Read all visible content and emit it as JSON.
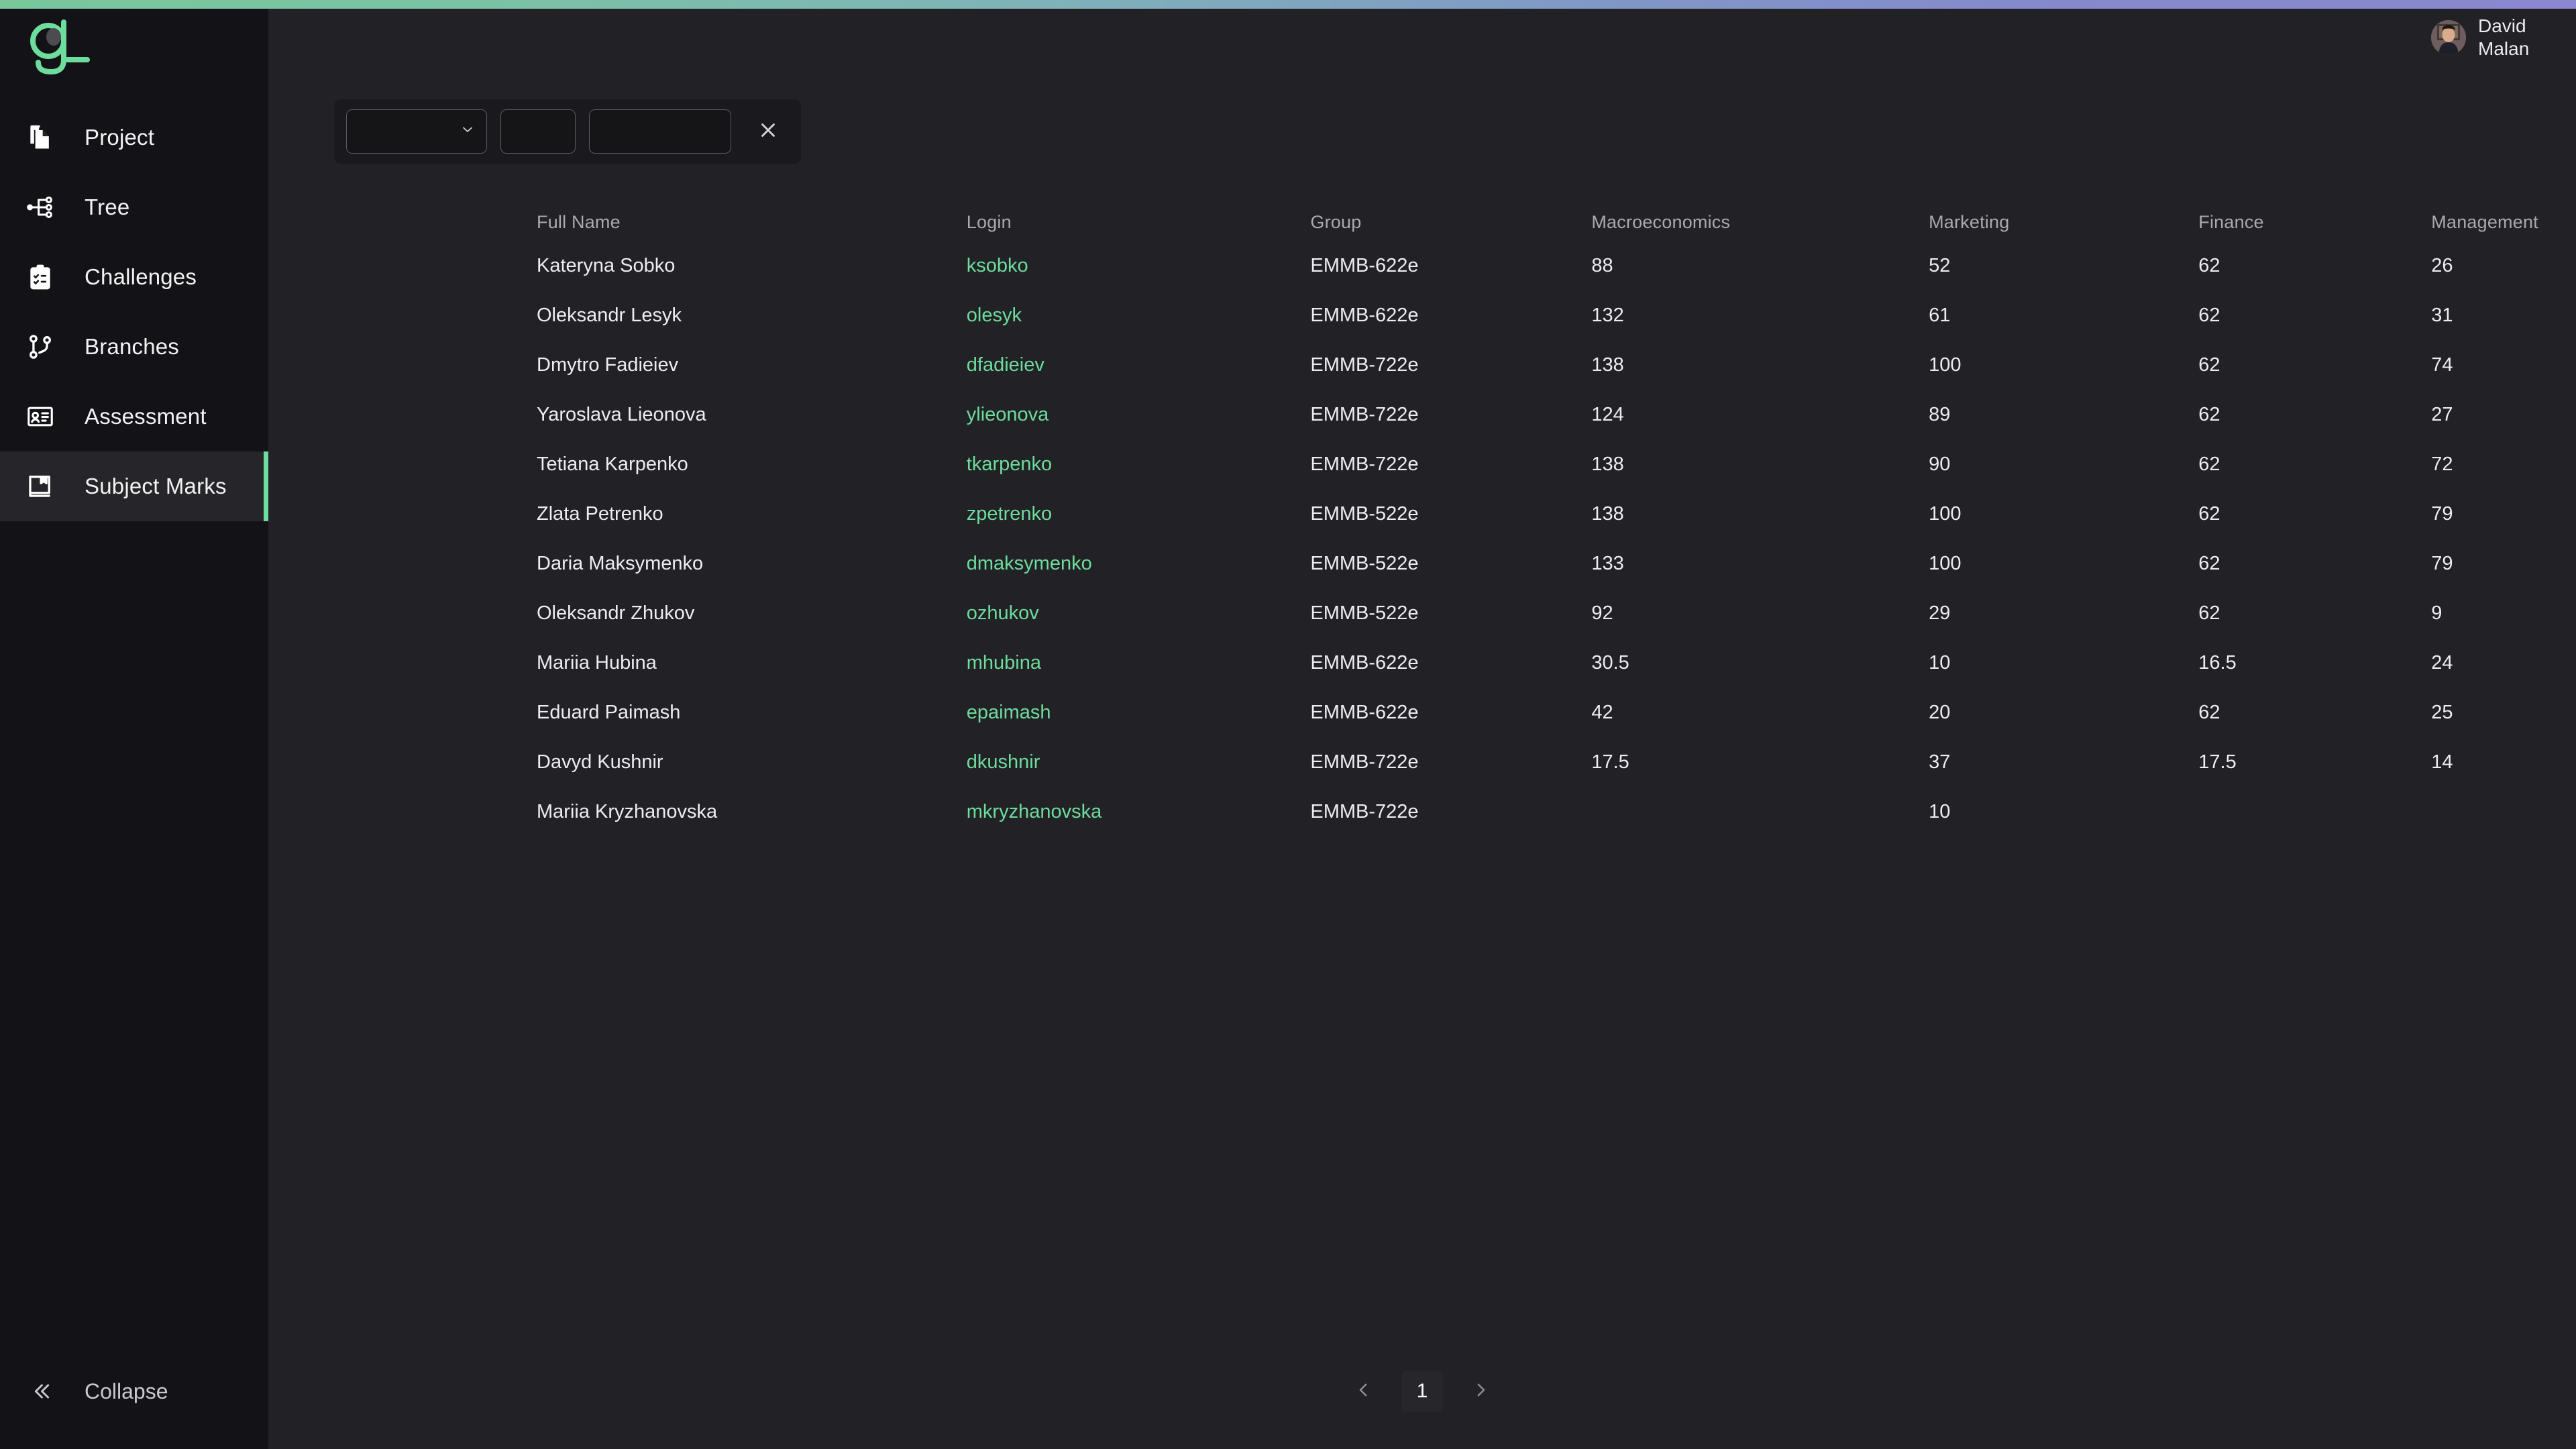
{
  "brand": {
    "logo_text": "gL",
    "accent": "#6ddc9c"
  },
  "topbar": {
    "gradient_from": "#79c79b",
    "gradient_to": "#8a88d0"
  },
  "user": {
    "name_line1": "David",
    "name_line2": "Malan"
  },
  "sidebar": {
    "items": [
      {
        "label": "Project",
        "icon": "files-icon",
        "active": false
      },
      {
        "label": "Tree",
        "icon": "hierarchy-tree-icon",
        "active": false
      },
      {
        "label": "Challenges",
        "icon": "clipboard-check-icon",
        "active": false
      },
      {
        "label": "Branches",
        "icon": "git-branch-icon",
        "active": false
      },
      {
        "label": "Assessment",
        "icon": "id-card-icon",
        "active": false
      },
      {
        "label": "Subject Marks",
        "icon": "book-bookmark-icon",
        "active": true
      }
    ],
    "collapse_label": "Collapse",
    "collapse_icon": "double-chevron-left-icon"
  },
  "filters": {
    "subject_select": {
      "value": "",
      "placeholder": "",
      "icon": "chevron-down-icon"
    },
    "min_field": {
      "value": "",
      "placeholder": ""
    },
    "max_field": {
      "value": "",
      "placeholder": ""
    },
    "clear_icon": "close-icon"
  },
  "table": {
    "columns": [
      "Full Name",
      "Login",
      "Group",
      "Macroeconomics",
      "Marketing",
      "Finance",
      "Management"
    ],
    "rows": [
      {
        "name": "Kateryna Sobko",
        "login": "ksobko",
        "group": "EMMB-622e",
        "macro": "88",
        "marketing": "52",
        "finance": "62",
        "management": "26"
      },
      {
        "name": "Oleksandr Lesyk",
        "login": "olesyk",
        "group": "EMMB-622e",
        "macro": "132",
        "marketing": "61",
        "finance": "62",
        "management": "31"
      },
      {
        "name": "Dmytro Fadieiev",
        "login": "dfadieiev",
        "group": "EMMB-722e",
        "macro": "138",
        "marketing": "100",
        "finance": "62",
        "management": "74"
      },
      {
        "name": "Yaroslava Lieonova",
        "login": "ylieonova",
        "group": "EMMB-722e",
        "macro": "124",
        "marketing": "89",
        "finance": "62",
        "management": "27"
      },
      {
        "name": "Tetiana Karpenko",
        "login": "tkarpenko",
        "group": "EMMB-722e",
        "macro": "138",
        "marketing": "90",
        "finance": "62",
        "management": "72"
      },
      {
        "name": "Zlata Petrenko",
        "login": "zpetrenko",
        "group": "EMMB-522e",
        "macro": "138",
        "marketing": "100",
        "finance": "62",
        "management": "79"
      },
      {
        "name": "Daria Maksymenko",
        "login": "dmaksymenko",
        "group": "EMMB-522e",
        "macro": "133",
        "marketing": "100",
        "finance": "62",
        "management": "79"
      },
      {
        "name": "Oleksandr Zhukov",
        "login": "ozhukov",
        "group": "EMMB-522e",
        "macro": "92",
        "marketing": "29",
        "finance": "62",
        "management": "9"
      },
      {
        "name": "Mariia Hubina",
        "login": "mhubina",
        "group": "EMMB-622e",
        "macro": "30.5",
        "marketing": "10",
        "finance": "16.5",
        "management": "24"
      },
      {
        "name": "Eduard Paimash",
        "login": "epaimash",
        "group": "EMMB-622e",
        "macro": "42",
        "marketing": "20",
        "finance": "62",
        "management": "25"
      },
      {
        "name": "Davyd Kushnir",
        "login": "dkushnir",
        "group": "EMMB-722e",
        "macro": "17.5",
        "marketing": "37",
        "finance": "17.5",
        "management": "14"
      },
      {
        "name": "Mariia Kryzhanovska",
        "login": "mkryzhanovska",
        "group": "EMMB-722e",
        "macro": "",
        "marketing": "10",
        "finance": "",
        "management": ""
      }
    ]
  },
  "pagination": {
    "prev_icon": "chevron-left-icon",
    "next_icon": "chevron-right-icon",
    "current_page": "1"
  }
}
